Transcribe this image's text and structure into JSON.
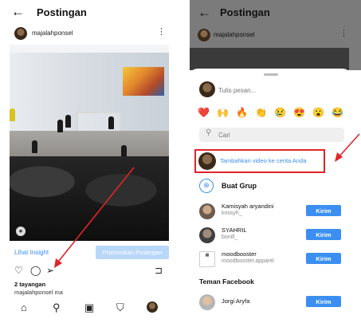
{
  "left": {
    "header": {
      "back_icon": "←",
      "title": "Postingan"
    },
    "post": {
      "username": "majalahponsel",
      "menu_icon": "⋮"
    },
    "actions": {
      "insight_link": "Lihat Insight",
      "promote_button": "Promosikan Postingan"
    },
    "icons": {
      "like": "♡",
      "comment": "◯",
      "share": "➢",
      "save": "⊐"
    },
    "views": "2 tayangan",
    "caption": "majalahponsel ma",
    "nav": {
      "home": "⌂",
      "search": "⚲",
      "reels": "▣",
      "shop": "⛉"
    }
  },
  "right": {
    "header": {
      "back_icon": "←",
      "title": "Postingan"
    },
    "post": {
      "username": "majalahponsel",
      "menu_icon": "⋮"
    },
    "sheet": {
      "message_placeholder": "Tulis pesan...",
      "emojis": [
        "❤️",
        "🙌",
        "🔥",
        "👏",
        "😢",
        "😍",
        "😮",
        "😂"
      ],
      "search_placeholder": "Cari",
      "add_story_label": "Tambahkan video ke cerita Anda",
      "create_group_label": "Buat Grup",
      "contacts": [
        {
          "name": "Kamisyah aryandini",
          "handle": "kmisyh_",
          "button": "Kirim"
        },
        {
          "name": "SYAHRIL",
          "handle": "bonill_",
          "button": "Kirim"
        },
        {
          "name": "moodbooster",
          "handle": "moodbooster.apparel",
          "button": "Kirim"
        }
      ],
      "facebook_section": "Teman Facebook",
      "facebook_contacts": [
        {
          "name": "Jorgi Aryfa",
          "button": "Kirim"
        }
      ]
    }
  },
  "colors": {
    "accent": "#3b8ff0",
    "highlight": "#e0242a",
    "promo_disabled": "#b9d7f9"
  }
}
